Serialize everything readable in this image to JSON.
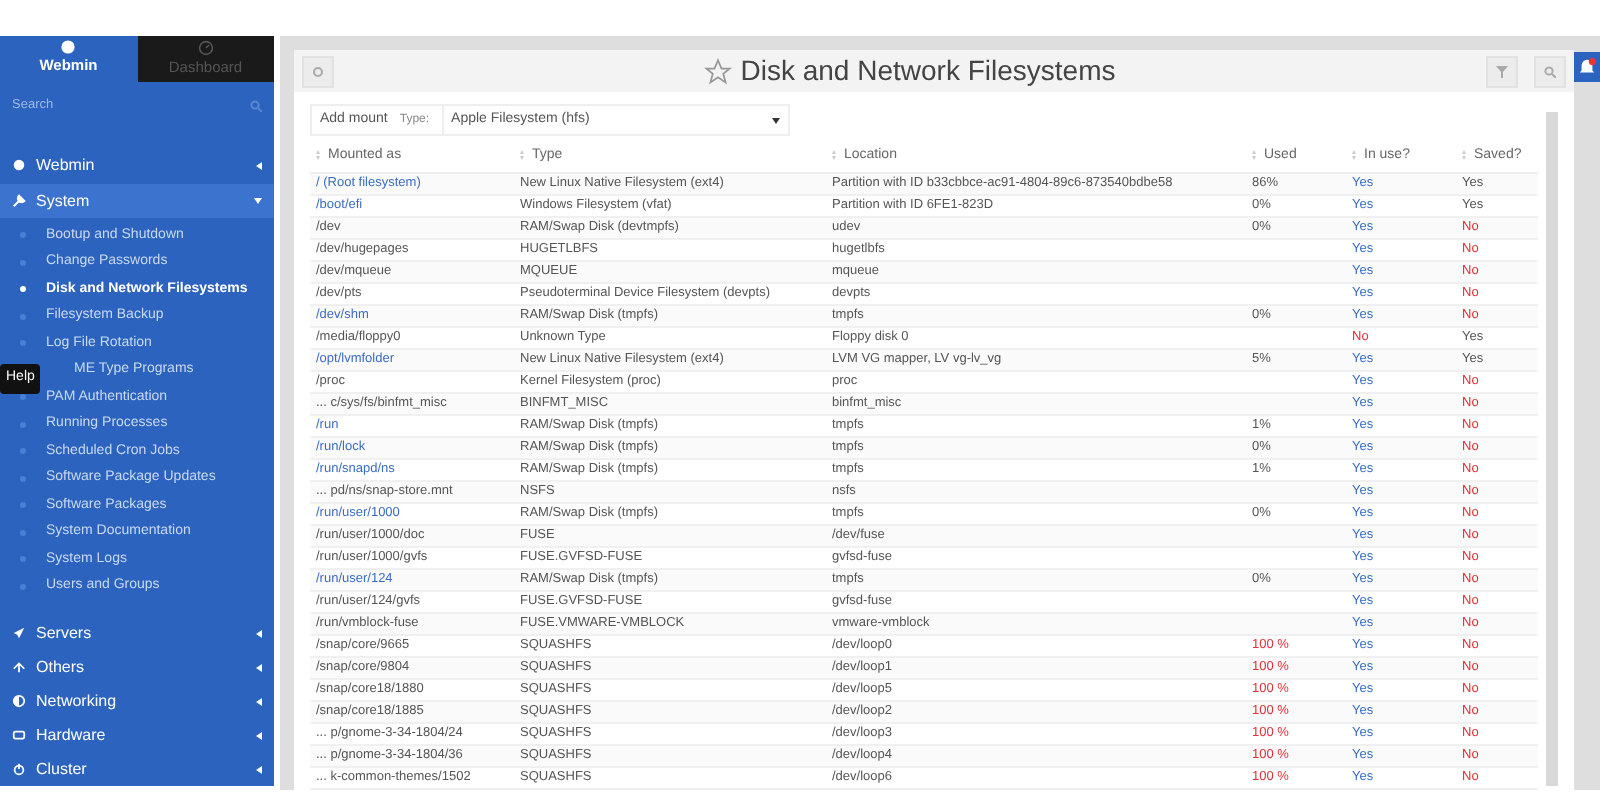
{
  "sidebar": {
    "tabs": [
      {
        "label": "Webmin",
        "selected": true
      },
      {
        "label": "Dashboard",
        "selected": false
      }
    ],
    "search": {
      "placeholder": "Search"
    },
    "items": [
      {
        "kind": "section",
        "label": "Webmin",
        "expanded": false
      },
      {
        "kind": "section",
        "label": "System",
        "expanded": true,
        "children": [
          {
            "label": "Bootup and Shutdown",
            "selected": false
          },
          {
            "label": "Change Passwords",
            "selected": false
          },
          {
            "label": "Disk and Network Filesystems",
            "selected": true
          },
          {
            "label": "Filesystem Backup",
            "selected": false
          },
          {
            "label": "Log File Rotation",
            "selected": false
          },
          {
            "label": "ME Type Programs",
            "selected": false
          },
          {
            "label": "PAM Authentication",
            "selected": false
          },
          {
            "label": "Running Processes",
            "selected": false
          },
          {
            "label": "Scheduled Cron Jobs",
            "selected": false
          },
          {
            "label": "Software Package Updates",
            "selected": false
          },
          {
            "label": "Software Packages",
            "selected": false
          },
          {
            "label": "System Documentation",
            "selected": false
          },
          {
            "label": "System Logs",
            "selected": false
          },
          {
            "label": "Users and Groups",
            "selected": false
          }
        ]
      },
      {
        "kind": "section",
        "label": "Servers",
        "expanded": false
      },
      {
        "kind": "section",
        "label": "Others",
        "expanded": false
      },
      {
        "kind": "section",
        "label": "Networking",
        "expanded": false
      },
      {
        "kind": "section",
        "label": "Hardware",
        "expanded": false
      },
      {
        "kind": "section",
        "label": "Cluster",
        "expanded": false
      }
    ],
    "tooltip": "Help"
  },
  "page": {
    "title": "Disk and Network Filesystems",
    "add_mount": "Add mount",
    "type_label": "Type:",
    "type_value": "Apple Filesystem (hfs)"
  },
  "table": {
    "columns": [
      "Mounted as",
      "Type",
      "Location",
      "Used",
      "In use?",
      "Saved?"
    ],
    "rows": [
      {
        "mounted": "/ (Root filesystem)",
        "link": true,
        "type": "New Linux Native Filesystem (ext4)",
        "location": "Partition with ID b33cbbce-ac91-4804-89c6-873540bdbe58",
        "used": "86%",
        "used_full": false,
        "in_use": "Yes",
        "in_use_ok": true,
        "saved": "Yes",
        "saved_ok": true
      },
      {
        "mounted": "/boot/efi",
        "link": true,
        "type": "Windows Filesystem (vfat)",
        "location": "Partition with ID 6FE1-823D",
        "used": "0%",
        "used_full": false,
        "in_use": "Yes",
        "in_use_ok": true,
        "saved": "Yes",
        "saved_ok": true
      },
      {
        "mounted": "/dev",
        "link": false,
        "type": "RAM/Swap Disk (devtmpfs)",
        "location": "udev",
        "used": "0%",
        "used_full": false,
        "in_use": "Yes",
        "in_use_ok": true,
        "saved": "No",
        "saved_ok": false
      },
      {
        "mounted": "/dev/hugepages",
        "link": false,
        "type": "HUGETLBFS",
        "location": "hugetlbfs",
        "in_use": "Yes",
        "in_use_ok": true,
        "saved": "No",
        "saved_ok": false
      },
      {
        "mounted": "/dev/mqueue",
        "link": false,
        "type": "MQUEUE",
        "location": "mqueue",
        "in_use": "Yes",
        "in_use_ok": true,
        "saved": "No",
        "saved_ok": false
      },
      {
        "mounted": "/dev/pts",
        "link": false,
        "type": "Pseudoterminal Device Filesystem (devpts)",
        "location": "devpts",
        "in_use": "Yes",
        "in_use_ok": true,
        "saved": "No",
        "saved_ok": false
      },
      {
        "mounted": "/dev/shm",
        "link": true,
        "type": "RAM/Swap Disk (tmpfs)",
        "location": "tmpfs",
        "used": "0%",
        "used_full": false,
        "in_use": "Yes",
        "in_use_ok": true,
        "saved": "No",
        "saved_ok": false
      },
      {
        "mounted": "/media/floppy0",
        "link": false,
        "type": "Unknown Type",
        "location": "Floppy disk 0",
        "in_use": "No",
        "in_use_ok": false,
        "saved": "Yes",
        "saved_ok": true
      },
      {
        "mounted": "/opt/lvmfolder",
        "link": true,
        "type": "New Linux Native Filesystem (ext4)",
        "location": "LVM VG mapper, LV vg-lv_vg",
        "used": "5%",
        "used_full": false,
        "in_use": "Yes",
        "in_use_ok": true,
        "saved": "Yes",
        "saved_ok": true
      },
      {
        "mounted": "/proc",
        "link": false,
        "type": "Kernel Filesystem (proc)",
        "location": "proc",
        "in_use": "Yes",
        "in_use_ok": true,
        "saved": "No",
        "saved_ok": false
      },
      {
        "mounted": "... c/sys/fs/binfmt_misc",
        "link": false,
        "type": "BINFMT_MISC",
        "location": "binfmt_misc",
        "in_use": "Yes",
        "in_use_ok": true,
        "saved": "No",
        "saved_ok": false
      },
      {
        "mounted": "/run",
        "link": true,
        "type": "RAM/Swap Disk (tmpfs)",
        "location": "tmpfs",
        "used": "1%",
        "used_full": false,
        "in_use": "Yes",
        "in_use_ok": true,
        "saved": "No",
        "saved_ok": false
      },
      {
        "mounted": "/run/lock",
        "link": true,
        "type": "RAM/Swap Disk (tmpfs)",
        "location": "tmpfs",
        "used": "0%",
        "used_full": false,
        "in_use": "Yes",
        "in_use_ok": true,
        "saved": "No",
        "saved_ok": false
      },
      {
        "mounted": "/run/snapd/ns",
        "link": true,
        "type": "RAM/Swap Disk (tmpfs)",
        "location": "tmpfs",
        "used": "1%",
        "used_full": false,
        "in_use": "Yes",
        "in_use_ok": true,
        "saved": "No",
        "saved_ok": false
      },
      {
        "mounted": "... pd/ns/snap-store.mnt",
        "link": false,
        "type": "NSFS",
        "location": "nsfs",
        "in_use": "Yes",
        "in_use_ok": true,
        "saved": "No",
        "saved_ok": false
      },
      {
        "mounted": "/run/user/1000",
        "link": true,
        "type": "RAM/Swap Disk (tmpfs)",
        "location": "tmpfs",
        "used": "0%",
        "used_full": false,
        "in_use": "Yes",
        "in_use_ok": true,
        "saved": "No",
        "saved_ok": false
      },
      {
        "mounted": "/run/user/1000/doc",
        "link": false,
        "type": "FUSE",
        "location": "/dev/fuse",
        "in_use": "Yes",
        "in_use_ok": true,
        "saved": "No",
        "saved_ok": false
      },
      {
        "mounted": "/run/user/1000/gvfs",
        "link": false,
        "type": "FUSE.GVFSD-FUSE",
        "location": "gvfsd-fuse",
        "in_use": "Yes",
        "in_use_ok": true,
        "saved": "No",
        "saved_ok": false
      },
      {
        "mounted": "/run/user/124",
        "link": true,
        "type": "RAM/Swap Disk (tmpfs)",
        "location": "tmpfs",
        "used": "0%",
        "used_full": false,
        "in_use": "Yes",
        "in_use_ok": true,
        "saved": "No",
        "saved_ok": false
      },
      {
        "mounted": "/run/user/124/gvfs",
        "link": false,
        "type": "FUSE.GVFSD-FUSE",
        "location": "gvfsd-fuse",
        "in_use": "Yes",
        "in_use_ok": true,
        "saved": "No",
        "saved_ok": false
      },
      {
        "mounted": "/run/vmblock-fuse",
        "link": false,
        "type": "FUSE.VMWARE-VMBLOCK",
        "location": "vmware-vmblock",
        "in_use": "Yes",
        "in_use_ok": true,
        "saved": "No",
        "saved_ok": false
      },
      {
        "mounted": "/snap/core/9665",
        "link": false,
        "type": "SQUASHFS",
        "location": "/dev/loop0",
        "used": "100 %",
        "used_full": true,
        "in_use": "Yes",
        "in_use_ok": true,
        "saved": "No",
        "saved_ok": false
      },
      {
        "mounted": "/snap/core/9804",
        "link": false,
        "type": "SQUASHFS",
        "location": "/dev/loop1",
        "used": "100 %",
        "used_full": true,
        "in_use": "Yes",
        "in_use_ok": true,
        "saved": "No",
        "saved_ok": false
      },
      {
        "mounted": "/snap/core18/1880",
        "link": false,
        "type": "SQUASHFS",
        "location": "/dev/loop5",
        "used": "100 %",
        "used_full": true,
        "in_use": "Yes",
        "in_use_ok": true,
        "saved": "No",
        "saved_ok": false
      },
      {
        "mounted": "/snap/core18/1885",
        "link": false,
        "type": "SQUASHFS",
        "location": "/dev/loop2",
        "used": "100 %",
        "used_full": true,
        "in_use": "Yes",
        "in_use_ok": true,
        "saved": "No",
        "saved_ok": false
      },
      {
        "mounted": "... p/gnome-3-34-1804/24",
        "link": false,
        "type": "SQUASHFS",
        "location": "/dev/loop3",
        "used": "100 %",
        "used_full": true,
        "in_use": "Yes",
        "in_use_ok": true,
        "saved": "No",
        "saved_ok": false
      },
      {
        "mounted": "... p/gnome-3-34-1804/36",
        "link": false,
        "type": "SQUASHFS",
        "location": "/dev/loop4",
        "used": "100 %",
        "used_full": true,
        "in_use": "Yes",
        "in_use_ok": true,
        "saved": "No",
        "saved_ok": false
      },
      {
        "mounted": "... k-common-themes/1502",
        "link": false,
        "type": "SQUASHFS",
        "location": "/dev/loop6",
        "used": "100 %",
        "used_full": true,
        "in_use": "Yes",
        "in_use_ok": true,
        "saved": "No",
        "saved_ok": false
      }
    ]
  }
}
